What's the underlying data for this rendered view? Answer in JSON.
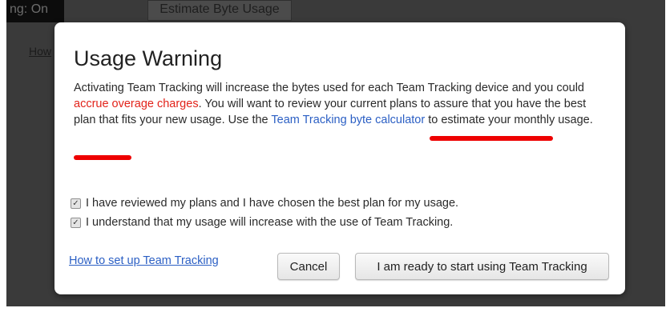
{
  "background": {
    "status_text": "ng: On",
    "estimate_button_label": "Estimate Byte Usage",
    "howto_link": "How"
  },
  "dialog": {
    "title": "Usage Warning",
    "body": {
      "part1": "Activating Team Tracking will increase the bytes used for each Team Tracking device and you could ",
      "warning": "accrue overage charges",
      "part2": ". You will want to review your current plans to assure that you have the best plan that fits your new usage. Use the ",
      "link": "Team Tracking byte calculator",
      "part3": " to estimate your monthly usage."
    },
    "checkboxes": [
      {
        "label": "I have reviewed my plans and I have chosen the best plan for my usage.",
        "checked": true
      },
      {
        "label": "I understand that my usage will increase with the use of Team Tracking.",
        "checked": true
      }
    ],
    "setup_link": "How to set up Team Tracking",
    "cancel_label": "Cancel",
    "confirm_label": "I am ready to start using Team Tracking"
  },
  "colors": {
    "warning": "#e2231a",
    "link": "#2b5fc4",
    "annotation": "#ee0000",
    "backdrop": "#3a3a3a"
  }
}
